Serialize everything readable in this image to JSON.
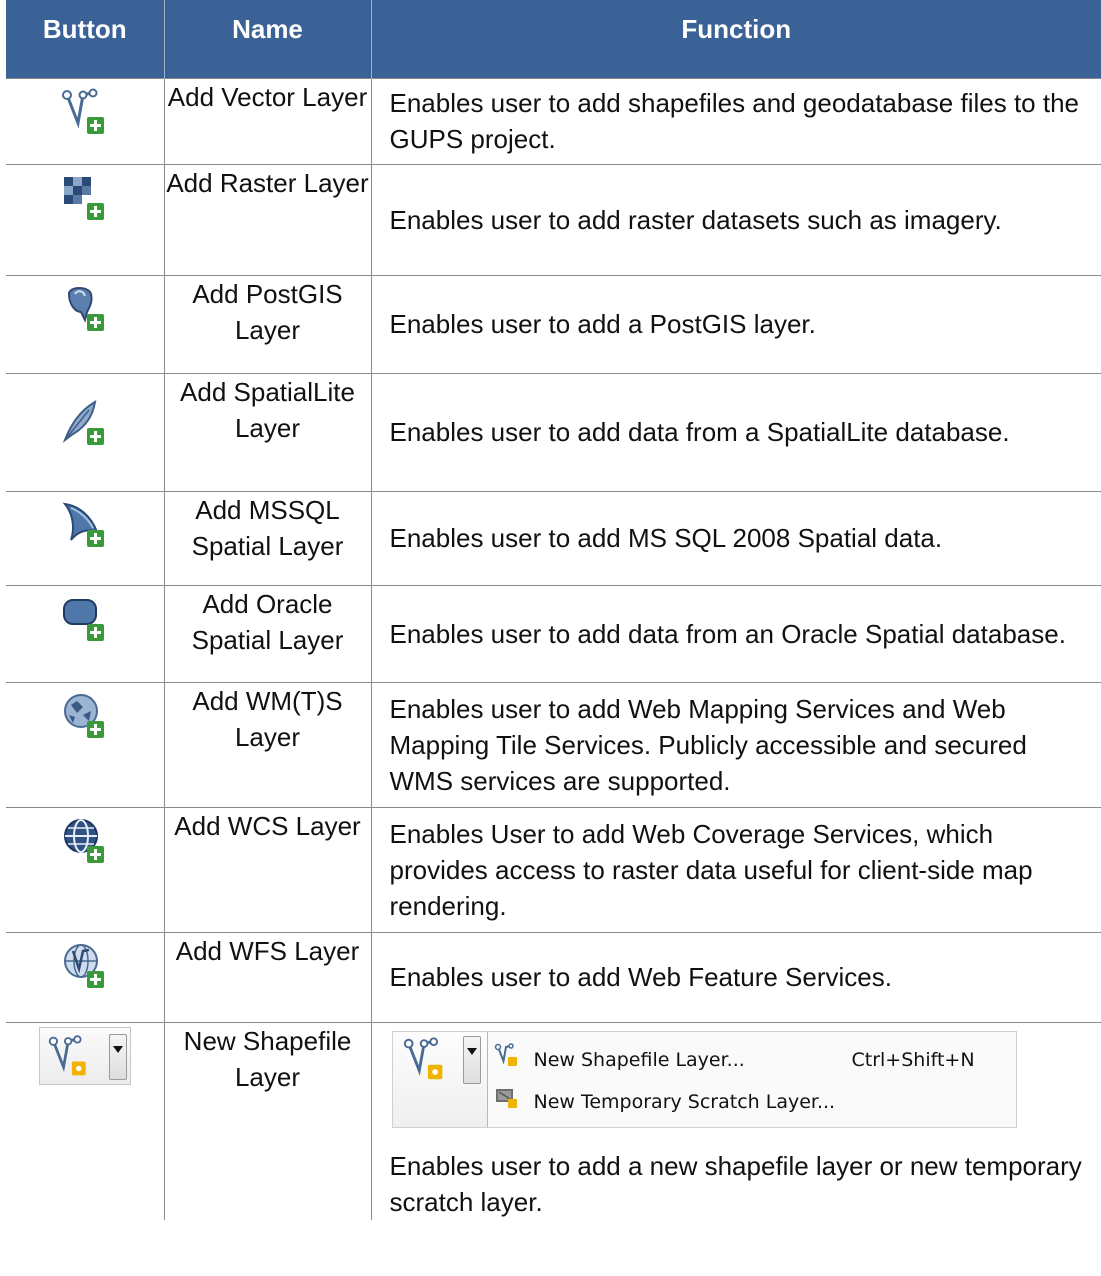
{
  "headers": {
    "button": "Button",
    "name": "Name",
    "function": "Function"
  },
  "rows": [
    {
      "icon": "add-vector-layer-icon",
      "name": "Add Vector Layer",
      "function": "Enables user to add shapefiles and geodatabase files to the GUPS project."
    },
    {
      "icon": "add-raster-layer-icon",
      "name": "Add Raster Layer",
      "function": "Enables user to add raster datasets such as imagery."
    },
    {
      "icon": "add-postgis-layer-icon",
      "name": "Add PostGIS Layer",
      "function": "Enables user to add a PostGIS layer."
    },
    {
      "icon": "add-spatialite-layer-icon",
      "name": "Add SpatialLite Layer",
      "function": "Enables user to add data from a SpatialLite database."
    },
    {
      "icon": "add-mssql-layer-icon",
      "name": "Add MSSQL Spatial Layer",
      "function": "Enables user to add MS SQL 2008 Spatial data."
    },
    {
      "icon": "add-oracle-layer-icon",
      "name": "Add Oracle Spatial Layer",
      "function": "Enables user to add data from an Oracle Spatial database."
    },
    {
      "icon": "add-wmts-layer-icon",
      "name": "Add WM(T)S Layer",
      "function": "Enables user to add Web Mapping Services and Web Mapping Tile Services. Publicly accessible and secured WMS services are supported."
    },
    {
      "icon": "add-wcs-layer-icon",
      "name": "Add WCS Layer",
      "function": "Enables User to add Web Coverage Services, which provides access to raster data useful for client-side map rendering."
    },
    {
      "icon": "add-wfs-layer-icon",
      "name": "Add WFS Layer",
      "function": "Enables user to add Web Feature Services."
    },
    {
      "icon": "new-shapefile-layer-icon",
      "name": "New Shapefile Layer",
      "function": "Enables user to add a new shapefile layer or new temporary scratch layer."
    }
  ],
  "menu": {
    "items": [
      {
        "label": "New Shapefile Layer...",
        "shortcut": "Ctrl+Shift+N",
        "icon": "new-shapefile-icon"
      },
      {
        "label": "New Temporary Scratch Layer...",
        "shortcut": "",
        "icon": "scratch-layer-icon"
      }
    ]
  },
  "colors": {
    "header_bg": "#3a6296",
    "header_text": "#ffffff",
    "plus_badge": "#3a9a3a"
  }
}
